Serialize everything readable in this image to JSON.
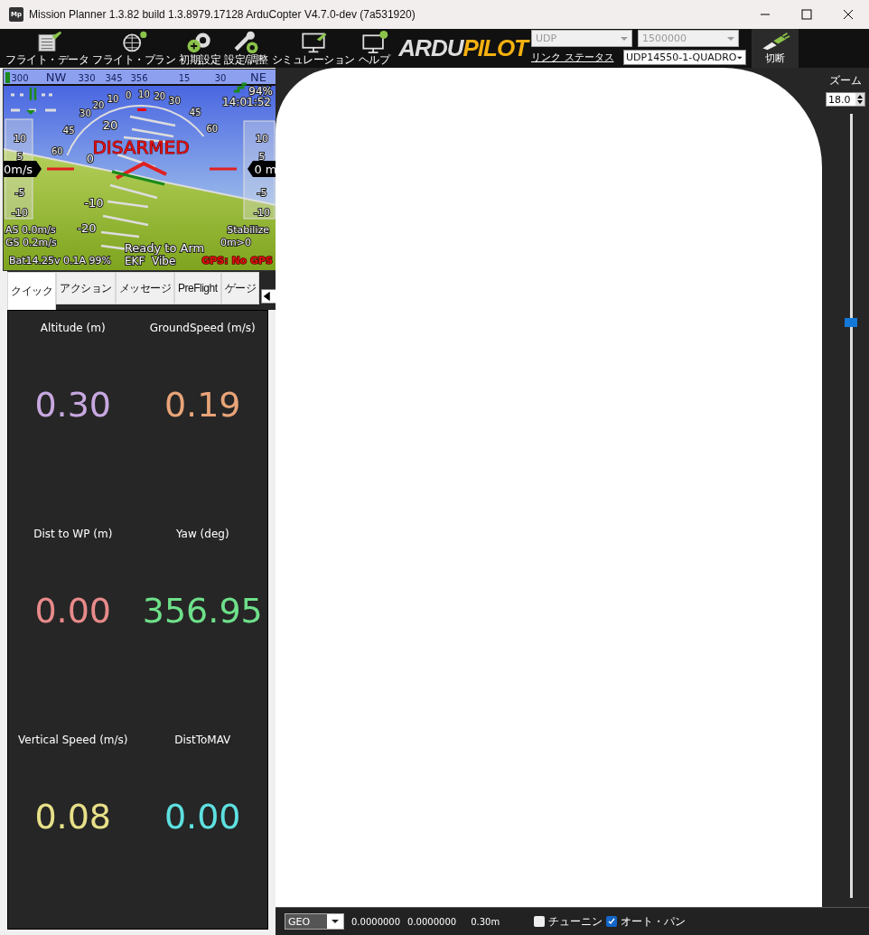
{
  "window": {
    "icon_text": "Mp",
    "title": "Mission Planner 1.3.82 build 1.3.8979.17128 ArduCopter V4.7.0-dev (7a531920)"
  },
  "toolbar": {
    "buttons": [
      {
        "kind": "data",
        "label": "フライト・データ"
      },
      {
        "kind": "plan",
        "label": "フライト・プラン"
      },
      {
        "kind": "setup",
        "label": "初期設定"
      },
      {
        "kind": "config",
        "label": "設定/調整"
      },
      {
        "kind": "sim",
        "label": "シミュレーション"
      },
      {
        "kind": "help",
        "label": "ヘルプ"
      }
    ],
    "logo": {
      "part_1": "ARDU",
      "part_2": "PILOT"
    },
    "connection_type": {
      "value": "UDP",
      "disabled": true
    },
    "baud_rate": {
      "value": "1500000",
      "disabled": true
    },
    "link_status": "リンク ステータス",
    "vehicle": {
      "value": "UDP14550-1-QUADRO"
    },
    "disconnect": "切断"
  },
  "hud": {
    "heading_tape": [
      "300",
      "NW",
      "330",
      "345",
      "356",
      "15",
      "30",
      "NE"
    ],
    "roll_scale": [
      "60",
      "45",
      "30",
      "20",
      "10",
      "0",
      "10",
      "20",
      "30",
      "45",
      "60"
    ],
    "pitch_labels": [
      "20",
      "0",
      "-10",
      "-20"
    ],
    "speed_tape": [
      "10",
      "5",
      "-5",
      "-10"
    ],
    "speed": "0m/s",
    "alt_tape": [
      "10",
      "5",
      "-5",
      "-10"
    ],
    "altitude": "0 m",
    "status": "DISARMED",
    "battery_remaining": "94%",
    "time": "14:01:52",
    "airspeed": "AS 0.0m/s",
    "groundspeed": "GS 0.2m/s",
    "mode": "Stabilize",
    "wp_distance": "0m>0",
    "message": "Ready to Arm",
    "battery": "Bat14.25v 0.1A 99%",
    "ekf": "EKF",
    "vibe": "Vibe",
    "gps": "GPS: No GPS"
  },
  "tabs": [
    {
      "label": "クイック",
      "selected": true
    },
    {
      "label": "アクション",
      "selected": false
    },
    {
      "label": "メッセージ",
      "selected": false
    },
    {
      "label": "PreFlight",
      "selected": false
    },
    {
      "label": "ゲージ",
      "selected": false
    }
  ],
  "quick": [
    {
      "label": "Altitude (m)",
      "value": "0.30",
      "color": "#c8a8e0"
    },
    {
      "label": "GroundSpeed (m/s)",
      "value": "0.19",
      "color": "#e8a478"
    },
    {
      "label": "Dist to WP (m)",
      "value": "0.00",
      "color": "#e88a8a"
    },
    {
      "label": "Yaw (deg)",
      "value": "356.95",
      "color": "#6ee08a"
    },
    {
      "label": "Vertical Speed (m/s)",
      "value": "0.08",
      "color": "#e8e088"
    },
    {
      "label": "DistToMAV",
      "value": "0.00",
      "color": "#5ee0e0"
    }
  ],
  "map": {
    "zoom_label": "ズーム",
    "zoom_value": "18.0",
    "zoom_slider": {
      "level": 0.74
    }
  },
  "status_bar": {
    "coord_system": "GEO",
    "latitude": "0.0000000",
    "longitude": "0.0000000",
    "altitude": "0.30m",
    "checks": [
      {
        "label": "チューニン",
        "checked": false
      },
      {
        "label": "オート・パン",
        "checked": true
      }
    ]
  }
}
